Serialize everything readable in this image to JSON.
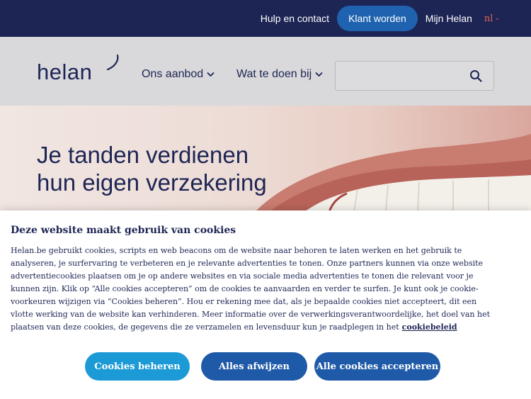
{
  "topbar": {
    "help_link": "Hulp en contact",
    "become_customer": "Klant worden",
    "my_account": "Mijn Helan",
    "language": "nl",
    "background_color": "#1d2554",
    "cta_color": "#1f63b0"
  },
  "header": {
    "logo_text": "helan",
    "nav": [
      {
        "label": "Ons aanbod"
      },
      {
        "label": "Wat te doen bij"
      }
    ],
    "search": {
      "value": "",
      "placeholder": ""
    },
    "background_color": "#d9d9db"
  },
  "hero": {
    "title": "Je tanden verdienen hun eigen verzekering",
    "text_color": "#1d2554"
  },
  "cookie_banner": {
    "title": "Deze website maakt gebruik van cookies",
    "body": "Helan.be gebruikt cookies, scripts en web beacons om de website naar behoren te laten werken en het gebruik te analyseren, je surfervaring te verbeteren en je relevante advertenties te tonen. Onze partners kunnen via onze website advertentiecookies plaatsen om je op andere websites en via sociale media advertenties te tonen die relevant voor je kunnen zijn. Klik op “Alle cookies accepteren” om de cookies te aanvaarden en verder te surfen. Je kunt ook je cookie-voorkeuren wijzigen via “Cookies beheren”. Hou er rekening mee dat, als je bepaalde cookies niet accepteert, dit een vlotte werking van de website kan verhinderen. Meer informatie over de verwerkingsverantwoordelijke, het doel van het plaatsen van deze cookies, de gegevens die ze verzamelen en levensduur kun je raadplegen in het",
    "policy_link": "cookiebeleid",
    "buttons": {
      "manage": "Cookies beheren",
      "reject": "Alles afwijzen",
      "accept": "Alle cookies accepteren"
    },
    "manage_color": "#1c9ad6",
    "primary_color": "#1f5aa8"
  }
}
